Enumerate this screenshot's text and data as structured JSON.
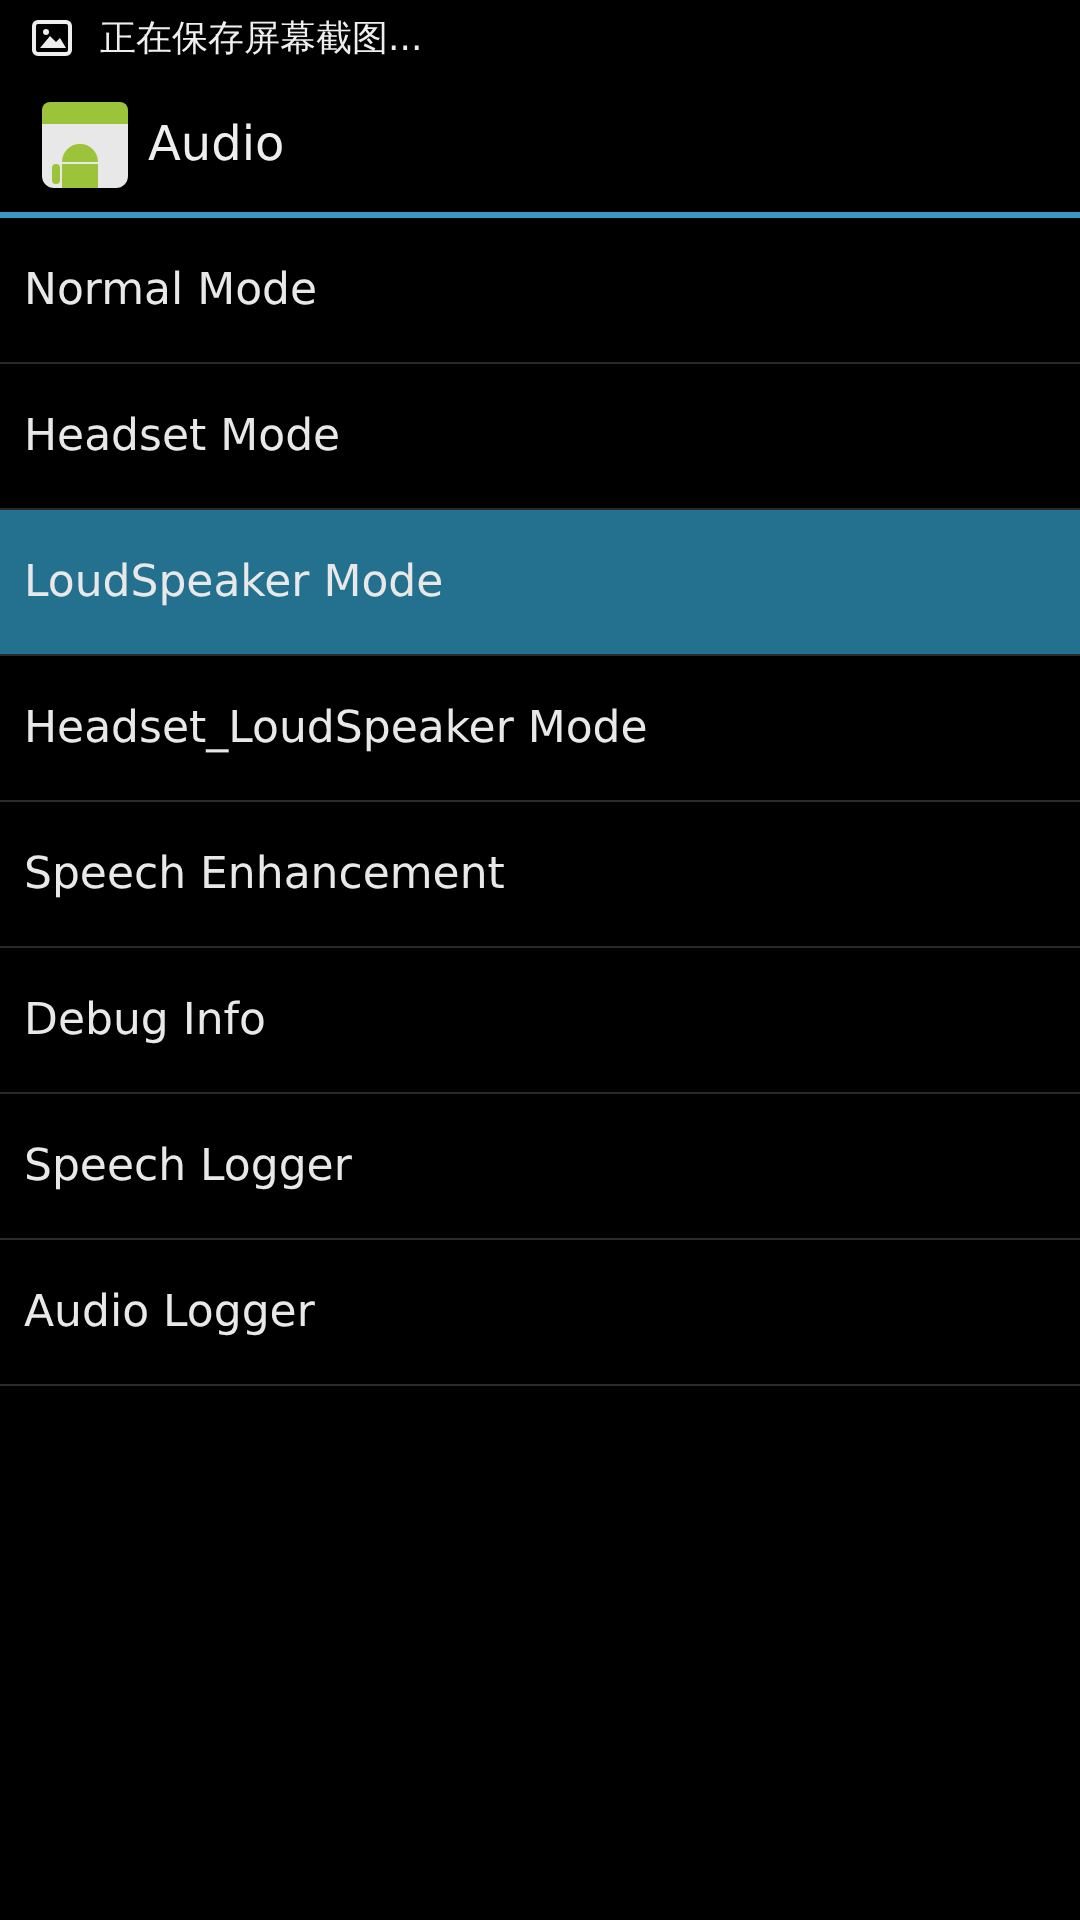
{
  "status_bar": {
    "notification": "正在保存屏幕截图..."
  },
  "action_bar": {
    "title": "Audio"
  },
  "items": [
    {
      "label": "Normal Mode",
      "selected": false
    },
    {
      "label": "Headset Mode",
      "selected": false
    },
    {
      "label": "LoudSpeaker Mode",
      "selected": true
    },
    {
      "label": "Headset_LoudSpeaker Mode",
      "selected": false
    },
    {
      "label": "Speech Enhancement",
      "selected": false
    },
    {
      "label": "Debug Info",
      "selected": false
    },
    {
      "label": "Speech Logger",
      "selected": false
    },
    {
      "label": "Audio Logger",
      "selected": false
    }
  ]
}
